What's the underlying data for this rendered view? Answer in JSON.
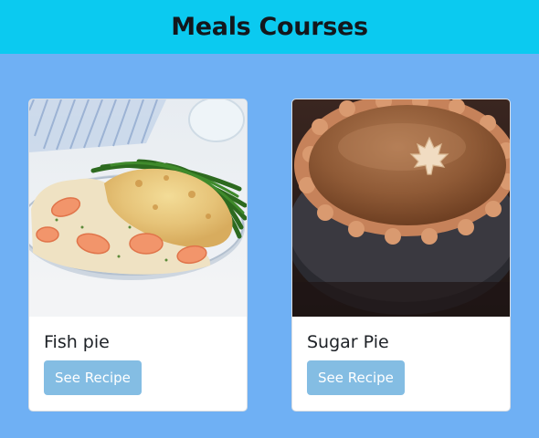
{
  "header": {
    "title": "Meals Courses"
  },
  "cards": [
    {
      "title": "Fish pie",
      "button_label": "See Recipe",
      "image_alt": "Fish pie photo"
    },
    {
      "title": "Sugar Pie",
      "button_label": "See Recipe",
      "image_alt": "Sugar pie photo"
    }
  ],
  "colors": {
    "page_background": "#6fb0f4",
    "header_background": "#0bcaf0",
    "button_background": "#84bde3",
    "card_background": "#ffffff"
  }
}
